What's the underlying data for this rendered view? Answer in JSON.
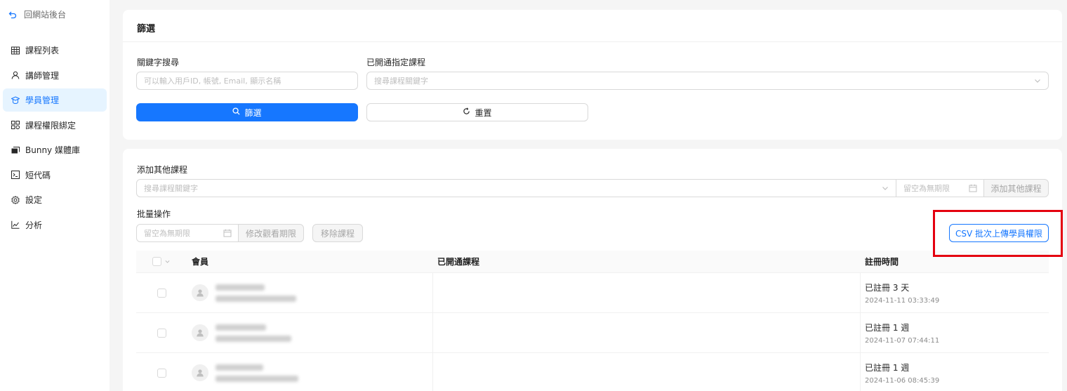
{
  "sidebar": {
    "back_label": "回網站後台",
    "items": [
      {
        "label": "課程列表",
        "icon": "table-icon"
      },
      {
        "label": "講師管理",
        "icon": "user-icon"
      },
      {
        "label": "學員管理",
        "icon": "student-icon",
        "active": true
      },
      {
        "label": "課程權限綁定",
        "icon": "grid-icon"
      },
      {
        "label": "Bunny 媒體庫",
        "icon": "media-icon"
      },
      {
        "label": "短代碼",
        "icon": "code-icon"
      },
      {
        "label": "設定",
        "icon": "gear-icon"
      },
      {
        "label": "分析",
        "icon": "chart-icon"
      }
    ]
  },
  "filter": {
    "title": "篩選",
    "keyword_label": "關鍵字搜尋",
    "keyword_placeholder": "可以輸入用戶ID, 帳號, Email, 顯示名稱",
    "course_label": "已開通指定課程",
    "course_placeholder": "搜尋課程關鍵字",
    "filter_button": "篩選",
    "reset_button": "重置"
  },
  "students": {
    "add_label": "添加其他課程",
    "add_course_placeholder": "搜尋課程關鍵字",
    "add_date_placeholder": "留空為無期限",
    "add_button": "添加其他課程",
    "batch_label": "批量操作",
    "batch_date_placeholder": "留空為無期限",
    "modify_button": "修改觀看期限",
    "remove_button": "移除課程",
    "csv_button": "CSV 批次上傳學員權限",
    "columns": {
      "member": "會員",
      "courses": "已開通課程",
      "registered": "註冊時間"
    },
    "rows": [
      {
        "reg_relative": "已註冊 3 天",
        "reg_date": "2024-11-11 03:33:49"
      },
      {
        "reg_relative": "已註冊 1 週",
        "reg_date": "2024-11-07 07:44:11"
      },
      {
        "reg_relative": "已註冊 1 週",
        "reg_date": "2024-11-06 08:45:39"
      }
    ]
  },
  "colors": {
    "accent": "#1677ff",
    "highlight": "#e4000f"
  }
}
